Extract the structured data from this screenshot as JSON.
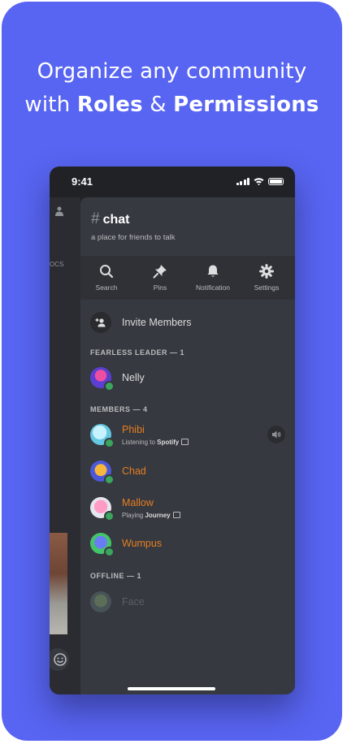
{
  "headline": {
    "line1": "Organize any community",
    "line2_prefix": "with ",
    "line2_bold1": "Roles",
    "line2_amp": " & ",
    "line2_bold2": "Permissions"
  },
  "status_bar": {
    "time": "9:41"
  },
  "left_column": {
    "partial_text": "OCS"
  },
  "channel": {
    "hash": "#",
    "name": "chat",
    "topic": "a place for friends to talk"
  },
  "toolbar": [
    {
      "label": "Search",
      "icon": "search-icon"
    },
    {
      "label": "Pins",
      "icon": "pin-icon"
    },
    {
      "label": "Notification",
      "icon": "bell-icon"
    },
    {
      "label": "Settings",
      "icon": "gear-icon"
    }
  ],
  "invite": {
    "label": "Invite Members"
  },
  "sections": {
    "leader": "FEARLESS LEADER — 1",
    "members": "MEMBERS — 4",
    "offline": "OFFLINE — 1"
  },
  "members": {
    "nelly": {
      "name": "Nelly",
      "color": "#dcddde"
    },
    "phibi": {
      "name": "Phibi",
      "activity_prefix": "Listening to ",
      "activity_bold": "Spotify",
      "color": "#e67e22"
    },
    "chad": {
      "name": "Chad",
      "color": "#e67e22"
    },
    "mallow": {
      "name": "Mallow",
      "activity_prefix": "Playing ",
      "activity_bold": "Journey",
      "color": "#e67e22"
    },
    "wumpus": {
      "name": "Wumpus",
      "color": "#e67e22"
    },
    "face": {
      "name": "Face",
      "color": "#5c5f66"
    }
  },
  "colors": {
    "background": "#5865F2",
    "panel": "#36393f",
    "toolbar": "#2f3136",
    "online": "#3ba55d",
    "role": "#e67e22"
  }
}
